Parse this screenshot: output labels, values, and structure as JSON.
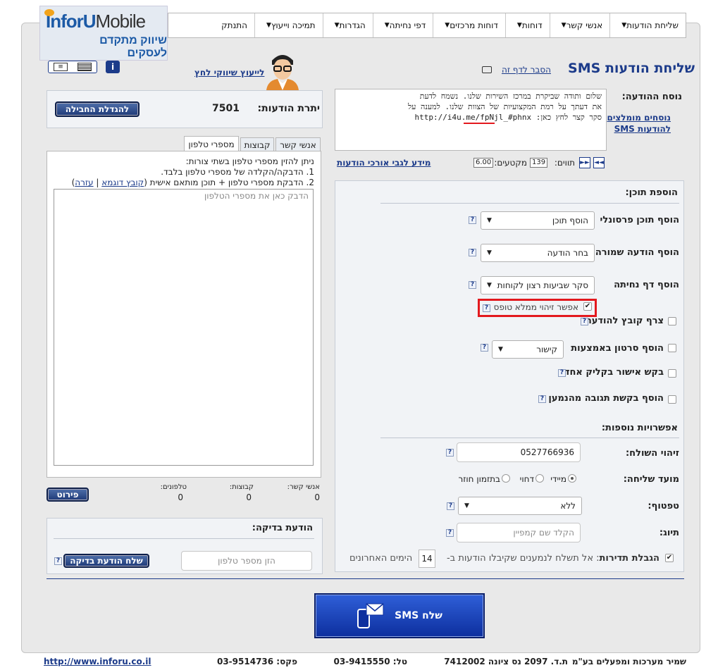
{
  "logo": {
    "brand_a": "InforU",
    "brand_b": "Mobile",
    "tagline": "שיווק מתקדם לעסקים"
  },
  "menu": [
    {
      "label": "שליחת הודעות",
      "dropdown": true
    },
    {
      "label": "אנשי קשר",
      "dropdown": true
    },
    {
      "label": "דוחות",
      "dropdown": true
    },
    {
      "label": "דוחות מרכזים",
      "dropdown": true
    },
    {
      "label": "דפי נחיתה",
      "dropdown": true
    },
    {
      "label": "הגדרות",
      "dropdown": true
    },
    {
      "label": "תמיכה וייעוץ",
      "dropdown": true
    },
    {
      "label": "התנתק",
      "dropdown": false
    }
  ],
  "page": {
    "title": "שליחת הודעות SMS",
    "explain_link": "הסבר לדף זה"
  },
  "consult": {
    "link": "לייעוץ שיווקי לחץ"
  },
  "message": {
    "label": "נוסח ההודעה:",
    "recommended_link_1": "נוסחים מומלצים",
    "recommended_link_2": "להודעות SMS",
    "line1": "שלום ותודה שביקרת במרכז השירות שלנו. נשמח לדעת",
    "line2": "את דעתך על רמת המקצועיות של הצוות שלנו. למענה על",
    "line3_pre": "סקר קצר לחץ כאן: ",
    "line3_link": "http://i4u.me/fpNjl_#phnx",
    "chars_label": "תווים:",
    "chars_value": "139",
    "segments_label": "מקטעים:",
    "segments_value": "6.00",
    "long_msg_link": "מידע לגבי אורכי הודעות"
  },
  "content": {
    "title": "הוספת תוכן:",
    "personal_label": "הוסף תוכן פרסונלי",
    "personal_value": "הוסף תוכן",
    "saved_label": "הוסף הודעה שמורה",
    "saved_value": "בחר הודעה",
    "landing_label": "הוסף דף נחיתה",
    "landing_value": "סקר שביעות רצון לקוחות",
    "autofill_label": "אפשר זיהוי ממלא טופס",
    "attach_label": "צרף קובץ להודעה",
    "video_label": "הוסף סרטון באמצעות",
    "video_value": "קישור",
    "approve_label": "בקש אישור בקליק אחד",
    "reply_label": "הוסף בקשת תגובה מהנמען"
  },
  "options": {
    "title": "אפשרויות נוספות:",
    "sender_label": "זיהוי השולח:",
    "sender_value": "0527766936",
    "timing_label": "מועד שליחה:",
    "timing_now": "מיידי",
    "timing_delay": "דחוי",
    "timing_recurring": "בתזמון חוזר",
    "footer_label": "טפטוף:",
    "footer_value": "ללא",
    "tag_label": "תיוג:",
    "tag_placeholder": "הקלד שם קמפיין",
    "freq_label": "הגבלת תדירות",
    "freq_text_a": ": אל תשלח לנמענים שקיבלו הודעות ב-",
    "freq_days": "14",
    "freq_text_b": "הימים האחרונים"
  },
  "balance": {
    "label": "יתרת הודעות:",
    "value": "7501",
    "upgrade_button": "להגדלת החבילה"
  },
  "tabs": {
    "contacts": "אנשי קשר",
    "groups": "קבוצות",
    "phones": "מספרי טלפון"
  },
  "phones": {
    "intro": "ניתן להזין מספרי טלפון בשתי צורות:",
    "opt1": "1. הדבקה/הקלדה של מספרי טלפון בלבד.",
    "opt2_pre": "2. הדבקת מספרי טלפון + תוכן מותאם אישית (",
    "sample_link": "קובץ דוגמא",
    "sep": " | ",
    "help_link": "עזרה",
    "opt2_post": ")",
    "placeholder": "הדבק כאן את מספרי הטלפון"
  },
  "counts": {
    "contacts_label": "אנשי קשר:",
    "contacts_value": "0",
    "groups_label": "קבוצות:",
    "groups_value": "0",
    "phones_label": "טלפונים:",
    "phones_value": "0",
    "details_button": "פירוט"
  },
  "test": {
    "title": "הודעת בדיקה:",
    "placeholder": "הזן מספר טלפון",
    "send_button": "שלח הודעת בדיקה"
  },
  "send": {
    "button": "שלח SMS"
  },
  "footer": {
    "company": "שמיר מערכות ומפעלים בע\"מ",
    "address": "ת.ד. 2097 נס ציונה 7412002",
    "phone": "טל: 03-9415550",
    "fax": "פקס: 03-9514736",
    "url": "http://www.inforu.co.il"
  },
  "colors": {
    "accent": "#1c3b8a",
    "highlight_box": "#e3191e",
    "send_button": "#1c47c6"
  }
}
